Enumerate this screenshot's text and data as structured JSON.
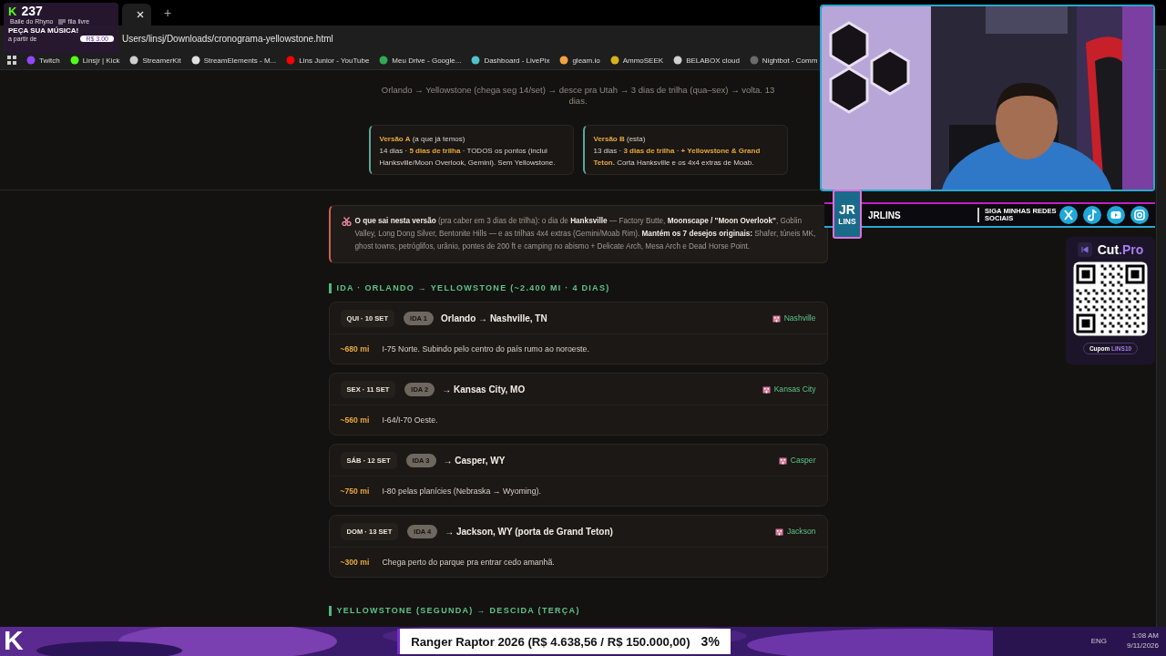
{
  "browser": {
    "new_tab": "+",
    "url": "Users/linsj/Downloads/cronograma-yellowstone.html",
    "bookmarks": [
      "Twitch",
      "Linsjr | Kick",
      "StreamerKit",
      "StreamElements - M...",
      "Lins Junior - YouTube",
      "Meu Drive - Google...",
      "Dashboard - LivePix",
      "gleam.io",
      "AmmoSEEK",
      "BELABOX cloud",
      "Nightbot - Comm"
    ]
  },
  "page": {
    "subtitle": "Orlando → Yellowstone (chega seg 14/set) → desce pra Utah → 3 dias de trilha (qua–sex) → volta. 13 dias.",
    "versions": [
      {
        "title": "**Versão A** (a que já temos)",
        "body": "14 dias · **5 dias de trilha** · TODOS os pontos (inclui Hanksville/Moon Overlook, Gemini). Sem Yellowstone."
      },
      {
        "title": "**Versão B** (esta)",
        "body": "13 dias · **3 dias de trilha** · **+ Yellowstone & Grand Teton.** Corta Hanksville e os 4x4 extras de Moab."
      }
    ],
    "note": "**O que sai nesta versão** (pra caber em 3 dias de trilha): o dia de **Hanksville** — Factory Butte, **Moonscape / \"Moon Overlook\"**, Goblin Valley, Long Dong Silver, Bentonite Hills — e as trilhas 4x4 extras (Gemini/Moab Rim). **Mantém os 7 desejos originais:** Shafer, túneis MK, ghost towns, petróglifos, urânio, pontes de 200 ft e camping no abismo + Delicate Arch, Mesa Arch e Dead Horse Point.",
    "sections": [
      {
        "title": "IDA · ORLANDO → YELLOWSTONE (~2.400 MI · 4 DIAS)",
        "days": [
          {
            "date": "QUI · 10 SET",
            "tag": "IDA 1",
            "route": "Orlando → Nashville, TN",
            "stay": "Nashville",
            "distance": "~680 mi",
            "detail": "I-75 Norte. Subindo pelo centro do país rumo ao noroeste."
          },
          {
            "date": "SEX · 11 SET",
            "tag": "IDA 2",
            "route": "→ Kansas City, MO",
            "stay": "Kansas City",
            "distance": "~560 mi",
            "detail": "I-64/I-70 Oeste."
          },
          {
            "date": "SÁB · 12 SET",
            "tag": "IDA 3",
            "route": "→ Casper, WY",
            "stay": "Casper",
            "distance": "~750 mi",
            "detail": "I-80 pelas planícies (Nebraska → Wyoming)."
          },
          {
            "date": "DOM · 13 SET",
            "tag": "IDA 4",
            "route": "→ Jackson, WY (porta de Grand Teton)",
            "stay": "Jackson",
            "distance": "~300 mi",
            "detail": "Chega perto do parque pra entrar cedo amanhã."
          }
        ]
      },
      {
        "title": "YELLOWSTONE (SEGUNDA) → DESCIDA (TERÇA)"
      }
    ]
  },
  "stream_overlay": {
    "song_widget": {
      "logo": "K",
      "count": "237",
      "track": "Baile do Rhyno",
      "queue": "fila livre",
      "call": "PEÇA SUA MÚSICA!",
      "price_label": "a partir de",
      "price": "R$ 3.00"
    },
    "social": {
      "logo_top": "JR",
      "logo_bottom": "LINS",
      "handle": "JRLINS",
      "call": "SIGA MINHAS REDES SOCIAIS"
    },
    "sponsor": {
      "brand": "Cut",
      "brand_suffix": ".Pro",
      "coupon_label": "Cupom",
      "coupon_code": "LINS10"
    },
    "corner_logo": "K",
    "goal": {
      "text": "Ranger Raptor 2026 (R$ 4.638,56 / R$ 150.000,00)",
      "percent": "3%"
    }
  },
  "taskbar": {
    "language": "ENG",
    "time": "1:08 AM",
    "date": "9/11/2026"
  }
}
